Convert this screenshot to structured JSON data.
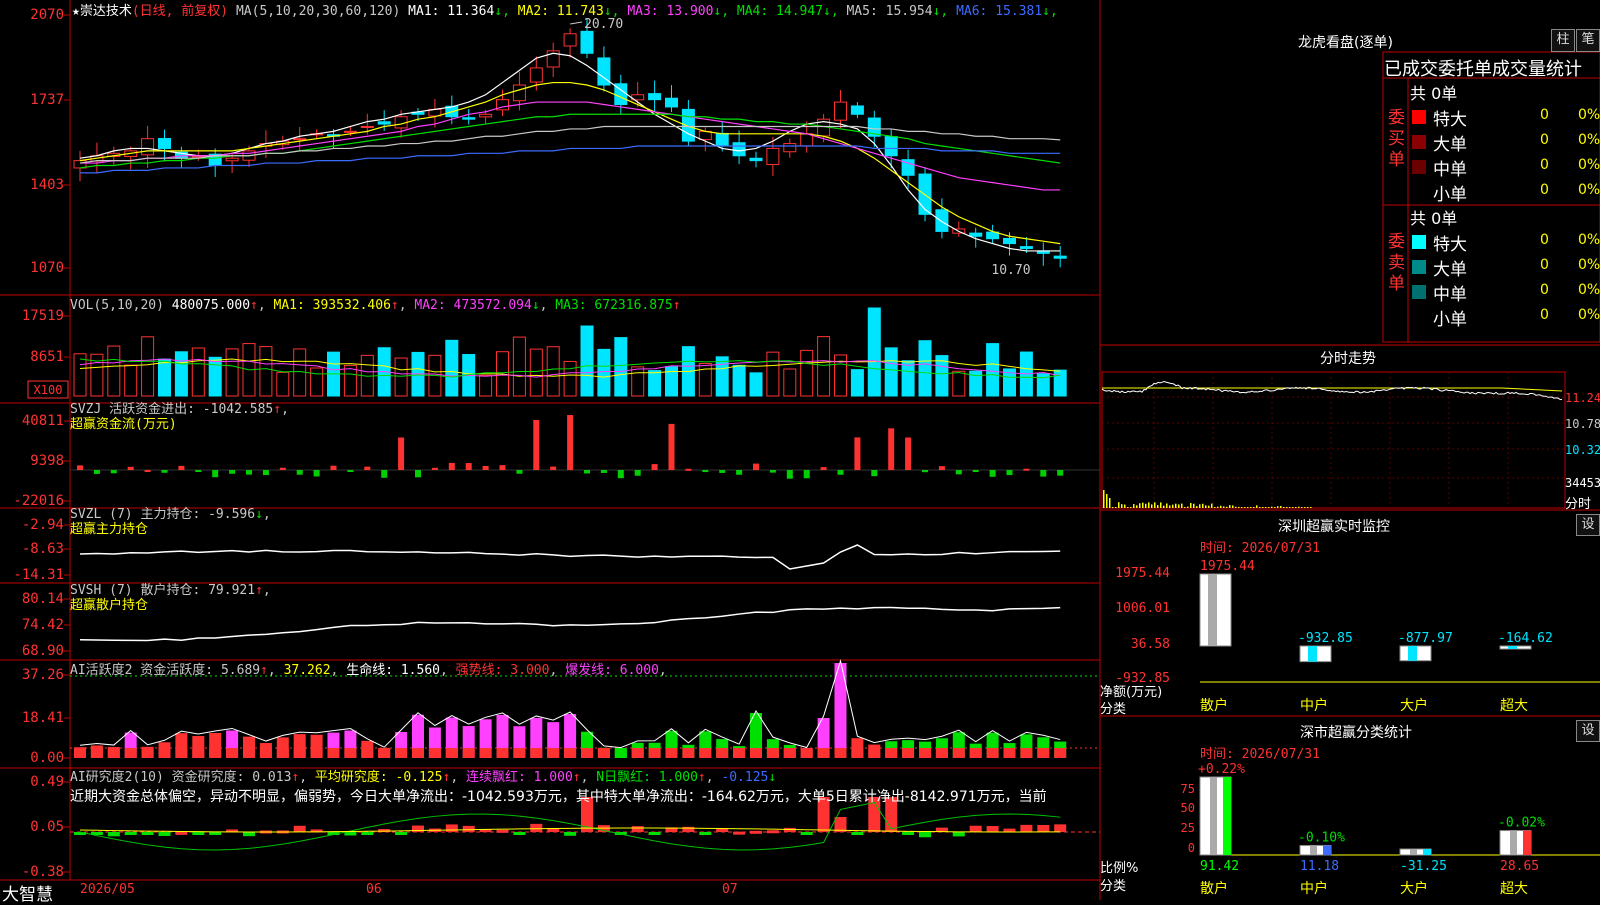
{
  "app": {
    "brand": "大智慧"
  },
  "main_chart": {
    "title": "★崇达技术",
    "mode": "(日线, 前复权)",
    "ma_header": "MA(5,10,20,30,60,120)",
    "legend": [
      {
        "label": "MA1: 11.364",
        "arrow": "↓",
        "color": "#ffffff"
      },
      {
        "label": "MA2: 11.743",
        "arrow": "↓",
        "color": "#ffff00"
      },
      {
        "label": "MA3: 13.900",
        "arrow": "↓",
        "color": "#ff40ff"
      },
      {
        "label": "MA4: 14.947",
        "arrow": "↓",
        "color": "#00e000"
      },
      {
        "label": "MA5: 15.954",
        "arrow": "↓",
        "color": "#c8c8c8"
      },
      {
        "label": "MA6: 15.381",
        "arrow": "↓",
        "color": "#3c6cff"
      }
    ],
    "y_ticks": [
      "2070",
      "1737",
      "1403",
      "1070"
    ],
    "high_label": "20.70",
    "low_label": "10.70"
  },
  "vol_panel": {
    "header": "VOL(5,10,20)",
    "value": "480075.000",
    "ma1": "MA1: 393532.406",
    "ma2": "MA2: 473572.094",
    "ma3": "MA3: 672316.875",
    "y_ticks": [
      "17519",
      "8651"
    ],
    "unit": "X100"
  },
  "svzj_panel": {
    "header": "SVZJ  活跃资金进出: -1042.585",
    "sub": "超赢资金流(万元)",
    "y_ticks": [
      "40811",
      "9398",
      "-22016"
    ]
  },
  "svzl_panel": {
    "header": "SVZL (7) 主力持仓: -9.596",
    "sub": "超赢主力持仓",
    "y_ticks": [
      "-2.94",
      "-8.63",
      "-14.31"
    ]
  },
  "svsh_panel": {
    "header": "SVSH (7) 散户持仓: 79.921",
    "sub": "超赢散户持仓",
    "y_ticks": [
      "80.14",
      "74.42",
      "68.90"
    ]
  },
  "ai_active": {
    "header": "AI活跃度2 资金活跃度: 5.689",
    "v2": "37.262",
    "life": "生命线: 1.560",
    "strong": "强势线: 3.000",
    "burst": "爆发线: 6.000",
    "y_ticks": [
      "37.26",
      "18.41",
      "0.00"
    ]
  },
  "ai_research": {
    "header": "AI研究度2(10) 资金研究度: 0.013",
    "avg": "平均研究度: -0.125",
    "cont": "连续飘红: 1.000",
    "nday": "N日飘红: 1.000",
    "last": "-0.125",
    "text": "近期大资金总体偏空，异动不明显，偏弱势，今日大单净流出：-1042.593万元，其中特大单净流出：-164.62万元，大单5日累计净出-8142.971万元，当前",
    "y_ticks": [
      "0.49",
      "0.05",
      "-0.38"
    ]
  },
  "x_axis": {
    "labels": [
      "2026/05",
      "06",
      "07"
    ]
  },
  "dragon_panel": {
    "title": "龙虎看盘(逐单)",
    "btn1": "柱",
    "btn2": "笔",
    "tabs": "已成交委托单成交量统计",
    "buy": {
      "side": "委买单",
      "total": "共 0单",
      "rows": [
        {
          "label": "特大",
          "count": "0",
          "pct": "0%",
          "color": "#ff0000"
        },
        {
          "label": "大单",
          "count": "0",
          "pct": "0%",
          "color": "#8b0000"
        },
        {
          "label": "中单",
          "count": "0",
          "pct": "0%",
          "color": "#6b0000"
        },
        {
          "label": "小单",
          "count": "0",
          "pct": "0%",
          "color": "#000000"
        }
      ]
    },
    "sell": {
      "side": "委卖单",
      "total": "共 0单",
      "rows": [
        {
          "label": "特大",
          "count": "0",
          "pct": "0%",
          "color": "#00ffff"
        },
        {
          "label": "大单",
          "count": "0",
          "pct": "0%",
          "color": "#008b8b"
        },
        {
          "label": "中单",
          "count": "0",
          "pct": "0%",
          "color": "#007070"
        },
        {
          "label": "小单",
          "count": "0",
          "pct": "0%",
          "color": "#000000"
        }
      ]
    }
  },
  "intraday": {
    "title": "分时走势",
    "y_labels": [
      "11.24",
      "10.78",
      "10.32"
    ],
    "vol_label": "34453",
    "footer": "分时"
  },
  "sz_monitor": {
    "title": "深圳超赢实时监控",
    "btn": "设",
    "time": "时间: 2026/07/31",
    "y_ticks": [
      "1975.44",
      "1006.01",
      "36.58",
      "-932.85"
    ],
    "top_label": "1975.44",
    "ylabel": "净额(万元)",
    "xlabel": "分类",
    "bars": [
      {
        "cat": "散户",
        "value": 1975.44,
        "label": ""
      },
      {
        "cat": "中户",
        "value": -932.85,
        "label": "-932.85"
      },
      {
        "cat": "大户",
        "value": -877.97,
        "label": "-877.97"
      },
      {
        "cat": "超大",
        "value": -164.62,
        "label": "-164.62"
      }
    ]
  },
  "sz_class": {
    "title": "深市超赢分类统计",
    "btn": "设",
    "time": "时间: 2026/07/31",
    "y_ticks": [
      "75",
      "50",
      "25",
      "0"
    ],
    "ylabel": "比例%",
    "xlabel": "分类",
    "bars": [
      {
        "cat": "散户",
        "value": 91.42,
        "label": "91.42",
        "top": "+0.22%",
        "color": "#00ff00"
      },
      {
        "cat": "中户",
        "value": 11.18,
        "label": "11.18",
        "top": "-0.10%",
        "color": "#3c6cff"
      },
      {
        "cat": "大户",
        "value": -31.25,
        "label": "-31.25",
        "top": "",
        "color": "#00e5ff"
      },
      {
        "cat": "超大",
        "value": 28.65,
        "label": "28.65",
        "top": "-0.02%",
        "color": "#ff3232"
      }
    ]
  },
  "chart_data": {
    "type": "candlestick",
    "title": "崇达技术",
    "x_dates": [
      "2026/05",
      "06",
      "07"
    ],
    "ylim": [
      10.7,
      20.7
    ],
    "close": [
      15.1,
      15.3,
      15.4,
      15.5,
      16.0,
      15.6,
      15.2,
      15.3,
      14.9,
      15.2,
      15.5,
      15.8,
      15.9,
      16.0,
      16.2,
      16.1,
      16.3,
      16.5,
      16.6,
      16.9,
      17.0,
      17.2,
      16.9,
      16.8,
      17.0,
      17.6,
      18.2,
      18.9,
      19.6,
      20.3,
      19.5,
      18.2,
      17.4,
      17.8,
      17.6,
      17.3,
      15.9,
      16.3,
      15.7,
      15.3,
      15.1,
      15.6,
      15.8,
      16.2,
      16.8,
      17.5,
      17.0,
      16.1,
      15.3,
      14.5,
      12.9,
      12.2,
      12.3,
      12.0,
      11.9,
      11.7,
      11.5,
      11.3,
      11.1
    ],
    "series": [
      {
        "name": "MA1",
        "values": [
          15.2,
          15.3,
          15.5,
          15.6,
          15.6,
          15.5,
          15.4,
          15.3,
          15.3,
          15.4,
          15.6,
          15.8,
          15.9,
          16.1,
          16.2,
          16.3,
          16.5,
          16.7,
          16.8,
          17.0,
          17.1,
          17.2,
          17.3,
          17.5,
          17.8,
          18.3,
          18.8,
          19.3,
          19.5,
          19.4,
          19.0,
          18.5,
          18.0,
          17.5,
          17.0,
          16.6,
          16.2,
          15.9,
          15.6,
          15.5,
          15.6,
          15.9,
          16.3,
          16.6,
          16.7,
          16.6,
          16.4,
          15.8,
          14.9,
          13.9,
          13.1,
          12.6,
          12.2,
          11.9,
          11.7,
          11.5,
          11.4,
          11.4,
          11.4
        ]
      },
      {
        "name": "MA2",
        "values": [
          15.1,
          15.2,
          15.3,
          15.4,
          15.5,
          15.5,
          15.5,
          15.5,
          15.5,
          15.5,
          15.6,
          15.7,
          15.8,
          15.9,
          16.0,
          16.1,
          16.2,
          16.3,
          16.5,
          16.6,
          16.8,
          16.9,
          17.1,
          17.3,
          17.5,
          17.8,
          18.0,
          18.2,
          18.3,
          18.3,
          18.2,
          18.0,
          17.7,
          17.4,
          17.1,
          16.8,
          16.5,
          16.3,
          16.2,
          16.2,
          16.2,
          16.2,
          16.2,
          16.2,
          16.1,
          15.9,
          15.6,
          15.2,
          14.7,
          14.2,
          13.7,
          13.2,
          12.8,
          12.5,
          12.2,
          12.0,
          11.9,
          11.8,
          11.7
        ]
      },
      {
        "name": "MA3",
        "values": [
          15.0,
          15.0,
          15.1,
          15.1,
          15.2,
          15.2,
          15.3,
          15.3,
          15.3,
          15.4,
          15.4,
          15.5,
          15.6,
          15.7,
          15.8,
          15.9,
          16.0,
          16.1,
          16.2,
          16.3,
          16.5,
          16.6,
          16.8,
          17.0,
          17.1,
          17.3,
          17.4,
          17.5,
          17.5,
          17.5,
          17.5,
          17.4,
          17.3,
          17.2,
          17.1,
          17.0,
          16.9,
          16.8,
          16.7,
          16.6,
          16.5,
          16.4,
          16.3,
          16.2,
          16.0,
          15.8,
          15.6,
          15.4,
          15.2,
          15.0,
          14.8,
          14.6,
          14.4,
          14.3,
          14.2,
          14.1,
          14.0,
          13.9,
          13.9
        ]
      },
      {
        "name": "MA4",
        "values": [
          14.8,
          14.9,
          14.9,
          15.0,
          15.0,
          15.1,
          15.1,
          15.2,
          15.2,
          15.3,
          15.3,
          15.4,
          15.4,
          15.5,
          15.6,
          15.7,
          15.8,
          15.9,
          16.0,
          16.1,
          16.2,
          16.3,
          16.4,
          16.5,
          16.6,
          16.7,
          16.8,
          16.9,
          16.9,
          17.0,
          17.0,
          17.0,
          17.0,
          17.0,
          17.0,
          17.0,
          16.9,
          16.9,
          16.8,
          16.8,
          16.7,
          16.7,
          16.6,
          16.6,
          16.5,
          16.4,
          16.3,
          16.2,
          16.1,
          16.0,
          15.8,
          15.7,
          15.6,
          15.5,
          15.4,
          15.3,
          15.2,
          15.1,
          15.0
        ]
      },
      {
        "name": "MA5",
        "values": [
          15.0,
          15.1,
          15.1,
          15.1,
          15.2,
          15.2,
          15.2,
          15.2,
          15.3,
          15.3,
          15.3,
          15.4,
          15.4,
          15.5,
          15.5,
          15.6,
          15.6,
          15.7,
          15.7,
          15.8,
          15.8,
          15.9,
          15.9,
          16.0,
          16.1,
          16.1,
          16.2,
          16.3,
          16.3,
          16.4,
          16.4,
          16.5,
          16.5,
          16.5,
          16.5,
          16.5,
          16.5,
          16.5,
          16.5,
          16.5,
          16.5,
          16.5,
          16.5,
          16.5,
          16.5,
          16.5,
          16.5,
          16.4,
          16.4,
          16.3,
          16.3,
          16.2,
          16.2,
          16.1,
          16.1,
          16.0,
          16.0,
          16.0,
          15.95
        ]
      },
      {
        "name": "MA6",
        "values": [
          14.6,
          14.6,
          14.7,
          14.7,
          14.7,
          14.8,
          14.8,
          14.8,
          14.9,
          14.9,
          14.9,
          15.0,
          15.0,
          15.0,
          15.1,
          15.1,
          15.1,
          15.2,
          15.2,
          15.2,
          15.3,
          15.3,
          15.3,
          15.4,
          15.4,
          15.4,
          15.5,
          15.5,
          15.5,
          15.6,
          15.6,
          15.6,
          15.6,
          15.7,
          15.7,
          15.7,
          15.7,
          15.7,
          15.7,
          15.7,
          15.7,
          15.7,
          15.7,
          15.7,
          15.7,
          15.7,
          15.7,
          15.6,
          15.6,
          15.6,
          15.6,
          15.5,
          15.5,
          15.5,
          15.5,
          15.4,
          15.4,
          15.4,
          15.4
        ]
      }
    ]
  }
}
